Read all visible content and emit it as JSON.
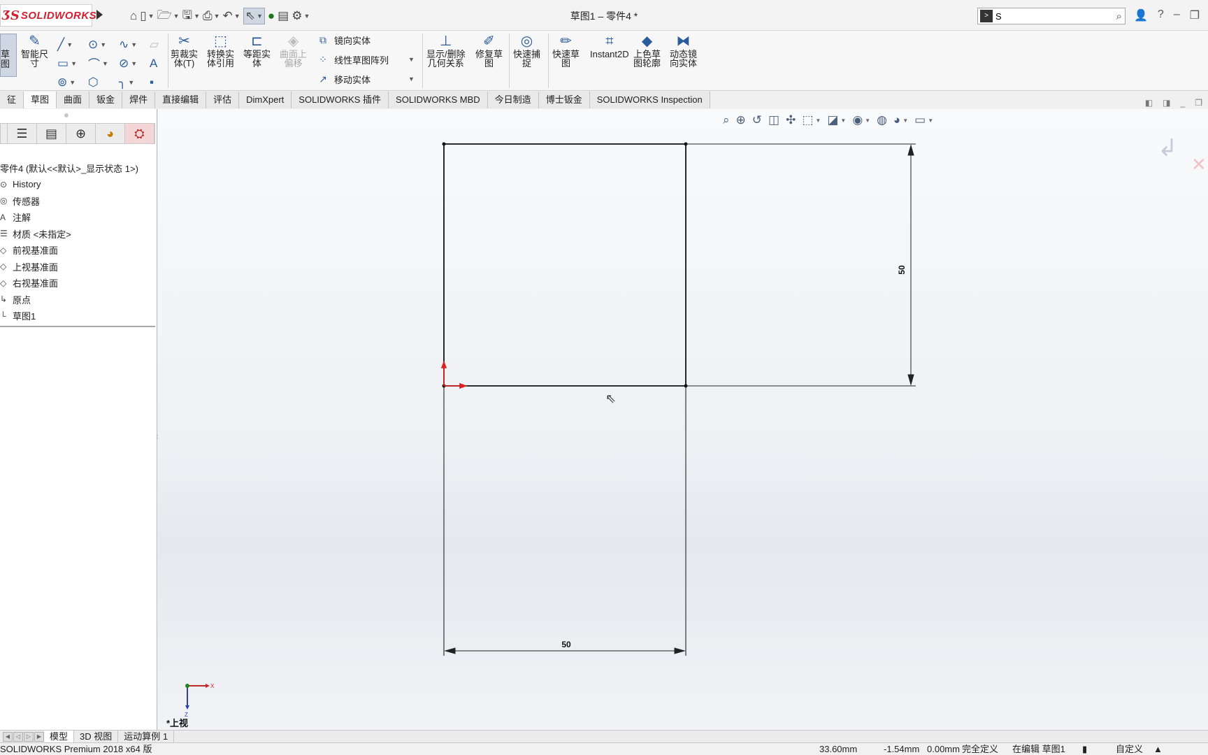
{
  "app": {
    "logo_ds": "ƷS",
    "logo_text": "SOLIDWORKS",
    "document_title": "草图1 – 零件4 *"
  },
  "quick_access": {
    "items": [
      {
        "name": "home-icon",
        "glyph": "⌂"
      },
      {
        "name": "new-document-icon",
        "glyph": "▯",
        "dropdown": true
      },
      {
        "name": "open-icon",
        "glyph": "📂",
        "dropdown": true
      },
      {
        "name": "save-icon",
        "glyph": "💾",
        "dropdown": true
      },
      {
        "name": "print-icon",
        "glyph": "⎙",
        "dropdown": true
      },
      {
        "name": "undo-icon",
        "glyph": "↶",
        "dropdown": true
      },
      {
        "name": "select-icon",
        "glyph": "⇖",
        "dropdown": true,
        "selected": true
      },
      {
        "name": "rebuild-icon",
        "glyph": "🚦"
      },
      {
        "name": "file-properties-icon",
        "glyph": "▤"
      },
      {
        "name": "options-icon",
        "glyph": "⚙",
        "dropdown": true
      }
    ]
  },
  "search": {
    "value": "S"
  },
  "ribbon": {
    "sketch_label": "草\n图",
    "smart_dimension": "智能尺\n寸",
    "trim": "剪裁实\n体(T)",
    "convert": "转换实\n体引用",
    "offset": "等距实\n体",
    "surface_offset": "曲面上\n偏移",
    "mirror": "镜向实体",
    "linear_pattern": "线性草图阵列",
    "move": "移动实体",
    "relations": "显示/删除\n几何关系",
    "repair": "修复草\n图",
    "quick_snaps": "快速捕\n捉",
    "rapid_sketch": "快速草\n图",
    "instant2d": "Instant2D",
    "shaded_contours": "上色草\n图轮廓",
    "dynamic_mirror": "动态镜\n向实体"
  },
  "tabs": [
    "征",
    "草图",
    "曲面",
    "钣金",
    "焊件",
    "直接编辑",
    "评估",
    "DimXpert",
    "SOLIDWORKS 插件",
    "SOLIDWORKS MBD",
    "今日制造",
    "博士钣金",
    "SOLIDWORKS Inspection"
  ],
  "active_tab_index": 1,
  "tree": {
    "root": "零件4 (默认<<默认>_显示状态 1>)",
    "nodes": [
      {
        "label": "History",
        "icon": "history-icon",
        "glyph": "⊙"
      },
      {
        "label": "传感器",
        "icon": "sensor-icon",
        "glyph": "◎"
      },
      {
        "label": "注解",
        "icon": "annotation-icon",
        "glyph": "A"
      },
      {
        "label": "材质 <未指定>",
        "icon": "material-icon",
        "glyph": "☰"
      },
      {
        "label": "前视基准面",
        "icon": "plane-icon",
        "glyph": "◇"
      },
      {
        "label": "上视基准面",
        "icon": "plane-icon",
        "glyph": "◇"
      },
      {
        "label": "右视基准面",
        "icon": "plane-icon",
        "glyph": "◇"
      },
      {
        "label": "原点",
        "icon": "origin-icon",
        "glyph": "↳"
      },
      {
        "label": "草图1",
        "icon": "sketch-icon",
        "glyph": "└"
      }
    ]
  },
  "sketch": {
    "dimension_horizontal": "50",
    "dimension_vertical": "50"
  },
  "view": {
    "name": "*上视"
  },
  "bottom_tabs": [
    "模型",
    "3D 视图",
    "运动算例 1"
  ],
  "status": {
    "product": "SOLIDWORKS Premium 2018 x64 版",
    "x": "33.60mm",
    "y": "-1.54mm",
    "z": "0.00mm",
    "state": "完全定义",
    "editing": "在编辑 草图1",
    "units": "自定义"
  },
  "colors": {
    "brand": "#d1202f",
    "accent": "#2a5b9a",
    "sketch_line": "#111111",
    "origin": "#e02020"
  }
}
